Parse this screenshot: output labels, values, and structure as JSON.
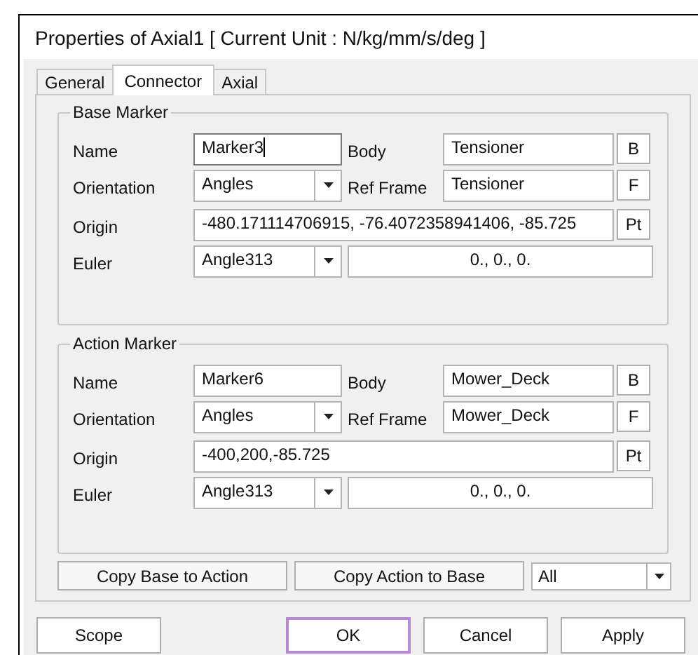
{
  "window": {
    "title": "Properties of Axial1 [ Current Unit : N/kg/mm/s/deg ]"
  },
  "tabs": [
    {
      "label": "General",
      "selected": false
    },
    {
      "label": "Connector",
      "selected": true
    },
    {
      "label": "Axial",
      "selected": false
    }
  ],
  "groups": [
    {
      "title": "Base Marker",
      "name_label": "Name",
      "name": "Marker3",
      "name_focused": true,
      "body_label": "Body",
      "body": "Tensioner",
      "body_button": "B",
      "orientation_label": "Orientation",
      "orientation": "Angles",
      "ref_frame_label": "Ref Frame",
      "ref_frame": "Tensioner",
      "ref_frame_button": "F",
      "origin_label": "Origin",
      "origin": "-480.171114706915, -76.4072358941406, -85.725",
      "origin_button": "Pt",
      "euler_label": "Euler",
      "euler_type": "Angle313",
      "euler_value": "0., 0., 0."
    },
    {
      "title": "Action Marker",
      "name_label": "Name",
      "name": "Marker6",
      "name_focused": false,
      "body_label": "Body",
      "body": "Mower_Deck",
      "body_button": "B",
      "orientation_label": "Orientation",
      "orientation": "Angles",
      "ref_frame_label": "Ref Frame",
      "ref_frame": "Mower_Deck",
      "ref_frame_button": "F",
      "origin_label": "Origin",
      "origin": "-400,200,-85.725",
      "origin_button": "Pt",
      "euler_label": "Euler",
      "euler_type": "Angle313",
      "euler_value": "0., 0., 0."
    }
  ],
  "copy_buttons": [
    "Copy Base to Action",
    "Copy Action to Base"
  ],
  "copy_scope": "All",
  "buttons": [
    {
      "label": "Scope",
      "default": false
    },
    {
      "label": "OK",
      "default": true
    },
    {
      "label": "Cancel",
      "default": false
    },
    {
      "label": "Apply",
      "default": false
    }
  ]
}
